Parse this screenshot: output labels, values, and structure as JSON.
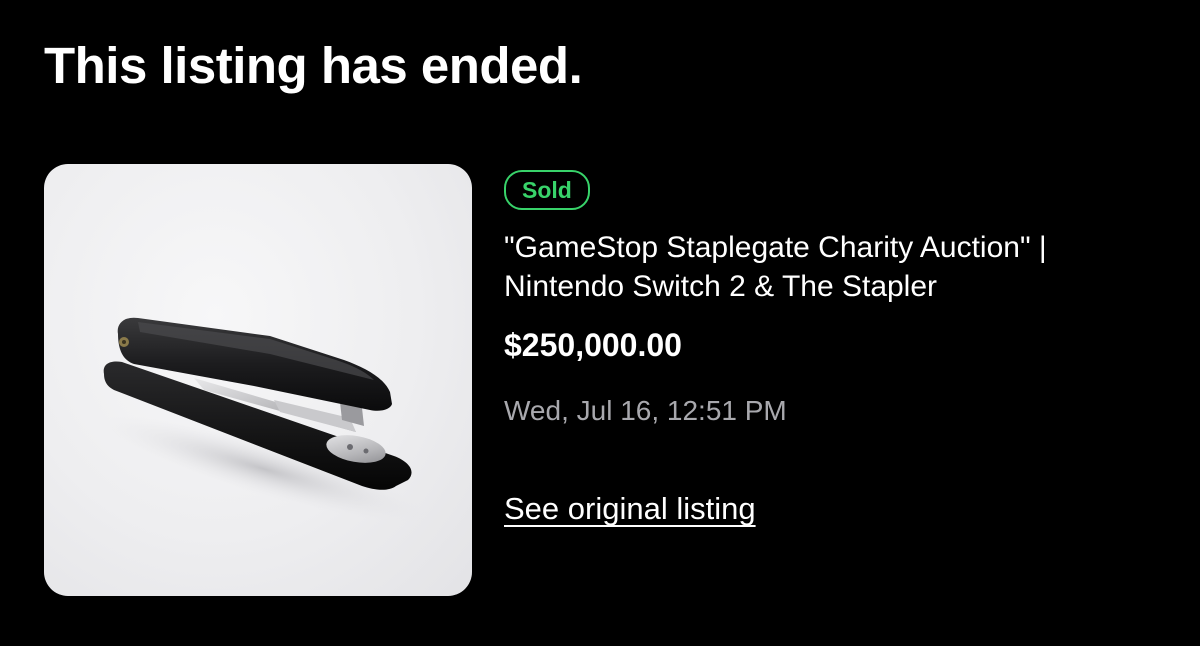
{
  "header": {
    "title": "This listing has ended."
  },
  "listing": {
    "image_alt": "Black stapler",
    "status_badge": "Sold",
    "title": "\"GameStop Staplegate Charity Auction\" | Nintendo Switch 2 & The Stapler",
    "price": "$250,000.00",
    "date": "Wed, Jul 16, 12:51 PM",
    "link_text": "See original listing"
  },
  "colors": {
    "background": "#000000",
    "text": "#ffffff",
    "sold_accent": "#38d36a",
    "muted_text": "#a8a8ad"
  }
}
